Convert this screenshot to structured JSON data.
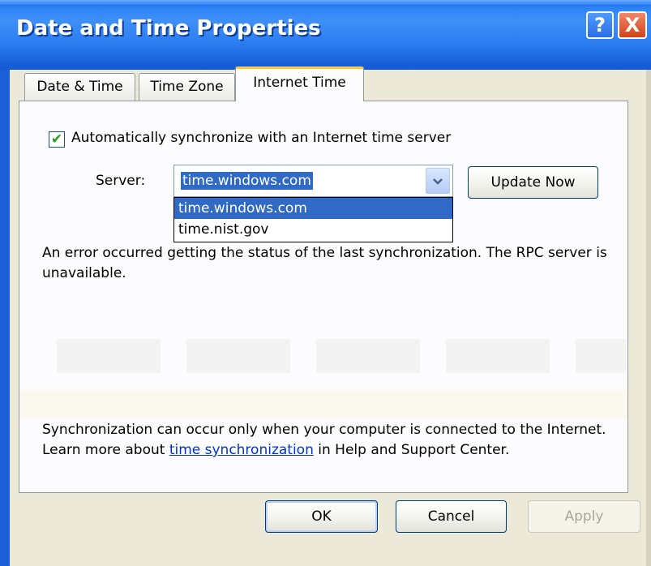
{
  "window": {
    "title": "Date and Time Properties",
    "help_label": "?",
    "close_label": "X"
  },
  "tabs": [
    {
      "label": "Date & Time",
      "active": false
    },
    {
      "label": "Time Zone",
      "active": false
    },
    {
      "label": "Internet Time",
      "active": true
    }
  ],
  "sync": {
    "checked": true,
    "checkbox_mark": "✔",
    "checkbox_label": "Automatically synchronize with an Internet time server"
  },
  "server": {
    "label": "Server:",
    "value": "time.windows.com",
    "options": [
      "time.windows.com",
      "time.nist.gov"
    ],
    "dropdown_arrow": "chevron-down-icon",
    "update_label": "Update Now"
  },
  "status_text": "An error occurred getting the status of the last synchronization.  The RPC server is unavailable.",
  "info": {
    "before_link": "Synchronization can occur only when your computer is connected to the Internet.  Learn more about ",
    "link_text": "time synchronization",
    "after_link": " in Help and Support Center."
  },
  "buttons": {
    "ok": "OK",
    "cancel": "Cancel",
    "apply": "Apply"
  },
  "colors": {
    "titlebar": "#2f84f5",
    "selection": "#316ac5",
    "tab_accent": "#ffc83c",
    "link": "#0033cc"
  }
}
